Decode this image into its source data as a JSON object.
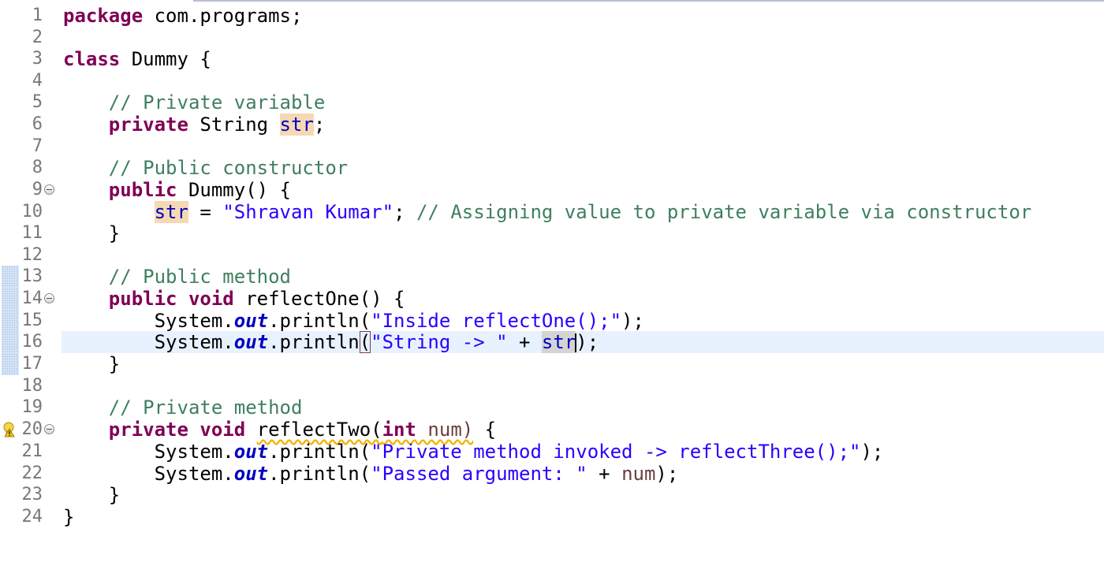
{
  "editor": {
    "language": "java",
    "colors": {
      "keyword": "#7f0055",
      "comment": "#3f7f5f",
      "string": "#2a00ff",
      "field": "#0000c0",
      "current_line": "#e8f2fe",
      "occurrence": "#f5d9b3",
      "line_number": "#787878"
    },
    "lines": [
      {
        "n": "1"
      },
      {
        "n": "2"
      },
      {
        "n": "3"
      },
      {
        "n": "4"
      },
      {
        "n": "5"
      },
      {
        "n": "6"
      },
      {
        "n": "7"
      },
      {
        "n": "8"
      },
      {
        "n": "9"
      },
      {
        "n": "10"
      },
      {
        "n": "11"
      },
      {
        "n": "12"
      },
      {
        "n": "13"
      },
      {
        "n": "14"
      },
      {
        "n": "15"
      },
      {
        "n": "16"
      },
      {
        "n": "17"
      },
      {
        "n": "18"
      },
      {
        "n": "19"
      },
      {
        "n": "20"
      },
      {
        "n": "21"
      },
      {
        "n": "22"
      },
      {
        "n": "23"
      },
      {
        "n": "24"
      }
    ],
    "tokens": {
      "l1_kw": "package",
      "l1_rest": " com.programs;",
      "l3_kw": "class",
      "l3_rest": " Dummy {",
      "l5_cm": "// Private variable",
      "l6_kw": "private",
      "l6_type": " String ",
      "l6_field": "str",
      "l6_end": ";",
      "l8_cm": "// Public constructor",
      "l9_kw": "public",
      "l9_rest": " Dummy() {",
      "l10_field": "str",
      "l10_eq": " = ",
      "l10_str": "\"Shravan Kumar\"",
      "l10_semi": "; ",
      "l10_cm": "// Assigning value to private variable via constructor",
      "l11": "}",
      "l13_cm": "// Public method",
      "l14_kw1": "public",
      "l14_sp": " ",
      "l14_kw2": "void",
      "l14_rest": " reflectOne() {",
      "l15_sys": "System.",
      "l15_out": "out",
      "l15_mid": ".println(",
      "l15_str": "\"Inside reflectOne();\"",
      "l15_end": ");",
      "l16_sys": "System.",
      "l16_out": "out",
      "l16_mid": ".println",
      "l16_paren": "(",
      "l16_str": "\"String -> \"",
      "l16_plus": " + ",
      "l16_field": "str",
      "l16_end": ");",
      "l17": "}",
      "l19_cm": "// Private method",
      "l20_kw1": "private",
      "l20_sp": " ",
      "l20_kw2": "void",
      "l20_sp2": " ",
      "l20_name": "reflectTwo(",
      "l20_int": "int",
      "l20_param": " num)",
      "l20_end": " {",
      "l21_sys": "System.",
      "l21_out": "out",
      "l21_mid": ".println(",
      "l21_str": "\"Private method invoked -> reflectThree();\"",
      "l21_end": ");",
      "l22_sys": "System.",
      "l22_out": "out",
      "l22_mid": ".println(",
      "l22_str": "\"Passed argument: \"",
      "l22_plus": " + ",
      "l22_param": "num",
      "l22_end": ");",
      "l23": "}",
      "l24": "}"
    },
    "icons": {
      "fold": "collapse-circle-icon",
      "warning": "lightbulb-warning-icon"
    }
  }
}
